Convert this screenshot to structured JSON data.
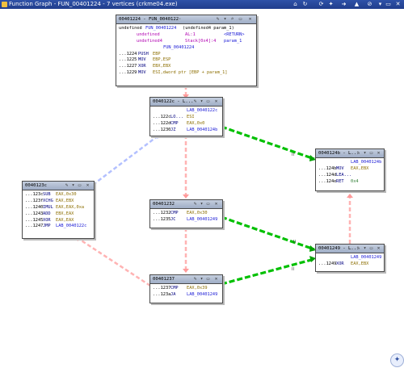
{
  "window": {
    "title": "Function Graph - FUN_00401224 - 7 vertices (crkme04.exe)",
    "toolbar_icons": [
      "home-icon",
      "refresh-icon",
      "sync-icon",
      "pin-icon",
      "arrow-icon",
      "close-red-icon",
      "dropdown-icon"
    ]
  },
  "edges": {
    "colors": {
      "fallthrough": "#ffb3b3",
      "conditional_true": "#00c000",
      "unconditional": "#b3c0ff"
    }
  },
  "blocks": {
    "b1224": {
      "title": "00401224 - FUN_0040122·",
      "sig": {
        "ret": "undefined",
        "name": "FUN_00401224",
        "params": "(undefined4 param_1)"
      },
      "vars": [
        {
          "type": "undefined",
          "name": "AL:1",
          "store": "<RETURN>"
        },
        {
          "type": "undefined4",
          "name": "Stack[0x4]:4",
          "store": "param_1"
        }
      ],
      "fnlabel": "FUN_00401224",
      "lines": [
        {
          "addr": "...1224",
          "mn": "PUSH",
          "op": "EBP"
        },
        {
          "addr": "...1225",
          "mn": "MOV",
          "op": "EBP,ESP"
        },
        {
          "addr": "...1227",
          "mn": "XOR",
          "op": "EBX,EBX"
        },
        {
          "addr": "...1229",
          "mn": "MOV",
          "op": "ESI,dword ptr [EBP + param_1]"
        }
      ]
    },
    "b122c": {
      "title": "0040122c - L...",
      "label": "LAB_0040122c",
      "lines": [
        {
          "addr": "...122c",
          "mn": "LO...",
          "op": "ESI"
        },
        {
          "addr": "...122d",
          "mn": "CMP",
          "op": "EAX,0x0"
        },
        {
          "addr": "...1230",
          "mn": "JZ",
          "op": "LAB_0040124b"
        }
      ]
    },
    "b123c": {
      "title": "0040123c",
      "lines": [
        {
          "addr": "...123c",
          "mn": "SUB",
          "op": "EAX,0x30"
        },
        {
          "addr": "...123f",
          "mn": "XCHG",
          "op": "EAX,EBX"
        },
        {
          "addr": "...1240",
          "mn": "IMUL",
          "op": "EAX,EAX,0xa"
        },
        {
          "addr": "...1243",
          "mn": "ADD",
          "op": "EBX,EAX"
        },
        {
          "addr": "...1245",
          "mn": "XOR",
          "op": "EAX,EAX"
        },
        {
          "addr": "...1247",
          "mn": "JMP",
          "op": "LAB_0040122c"
        }
      ]
    },
    "b1232": {
      "title": "00401232",
      "lines": [
        {
          "addr": "...1232",
          "mn": "CMP",
          "op": "EAX,0x30"
        },
        {
          "addr": "...1235",
          "mn": "JC",
          "op": "LAB_00401249"
        }
      ]
    },
    "b1237": {
      "title": "00401237",
      "lines": [
        {
          "addr": "...1237",
          "mn": "CMP",
          "op": "EAX,0x39"
        },
        {
          "addr": "...123a",
          "mn": "JA",
          "op": "LAB_00401249"
        }
      ]
    },
    "b124b": {
      "title": "0040124b - L...",
      "label": "LAB_0040124b",
      "lines": [
        {
          "addr": "...124b",
          "mn": "MOV",
          "op": "EAX,EBX"
        },
        {
          "addr": "...124d",
          "mn": "LEA...",
          "op": ""
        },
        {
          "addr": "...124e",
          "mn": "RET",
          "op": "0x4"
        }
      ]
    },
    "b1249": {
      "title": "00401249 - L...",
      "label": "LAB_00401249",
      "lines": [
        {
          "addr": "...1249",
          "mn": "XOR",
          "op": "EAX,EBX"
        }
      ]
    }
  }
}
